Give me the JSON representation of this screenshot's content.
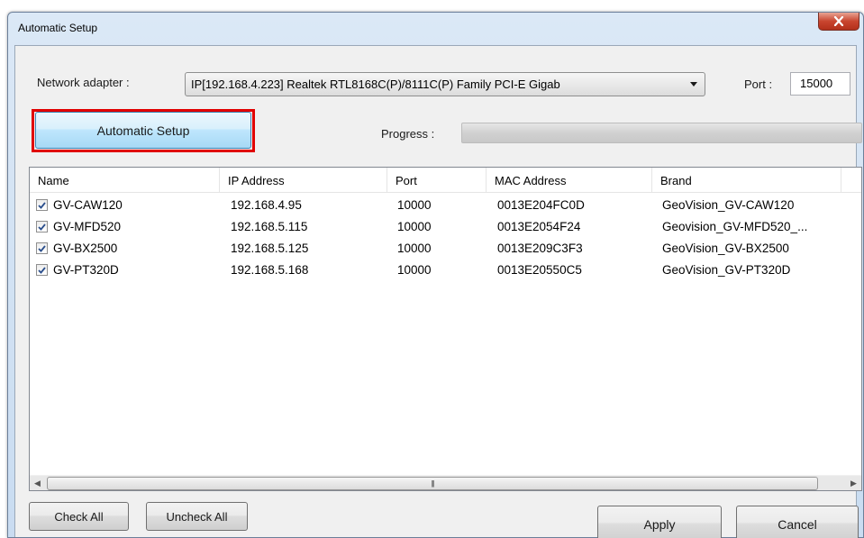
{
  "window": {
    "title": "Automatic Setup"
  },
  "adapter": {
    "label": "Network adapter :",
    "selected": "IP[192.168.4.223] Realtek RTL8168C(P)/8111C(P) Family PCI-E Gigab"
  },
  "port": {
    "label": "Port :",
    "value": "15000"
  },
  "automatic_setup_label": "Automatic Setup",
  "progress": {
    "label": "Progress :",
    "value_percent": 0
  },
  "table": {
    "columns": [
      "Name",
      "IP Address",
      "Port",
      "MAC Address",
      "Brand"
    ],
    "rows": [
      {
        "checked": true,
        "name": "GV-CAW120",
        "ip": "192.168.4.95",
        "port": "10000",
        "mac": "0013E204FC0D",
        "brand": "GeoVision_GV-CAW120"
      },
      {
        "checked": true,
        "name": "GV-MFD520",
        "ip": "192.168.5.115",
        "port": "10000",
        "mac": "0013E2054F24",
        "brand": "Geovision_GV-MFD520_..."
      },
      {
        "checked": true,
        "name": "GV-BX2500",
        "ip": "192.168.5.125",
        "port": "10000",
        "mac": "0013E209C3F3",
        "brand": "GeoVision_GV-BX2500"
      },
      {
        "checked": true,
        "name": "GV-PT320D",
        "ip": "192.168.5.168",
        "port": "10000",
        "mac": "0013E20550C5",
        "brand": "GeoVision_GV-PT320D"
      }
    ]
  },
  "buttons": {
    "check_all": "Check All",
    "uncheck_all": "Uncheck All",
    "apply": "Apply",
    "cancel": "Cancel"
  },
  "colors": {
    "highlight": "#e00000",
    "checkmark": "#2a4e8c"
  }
}
